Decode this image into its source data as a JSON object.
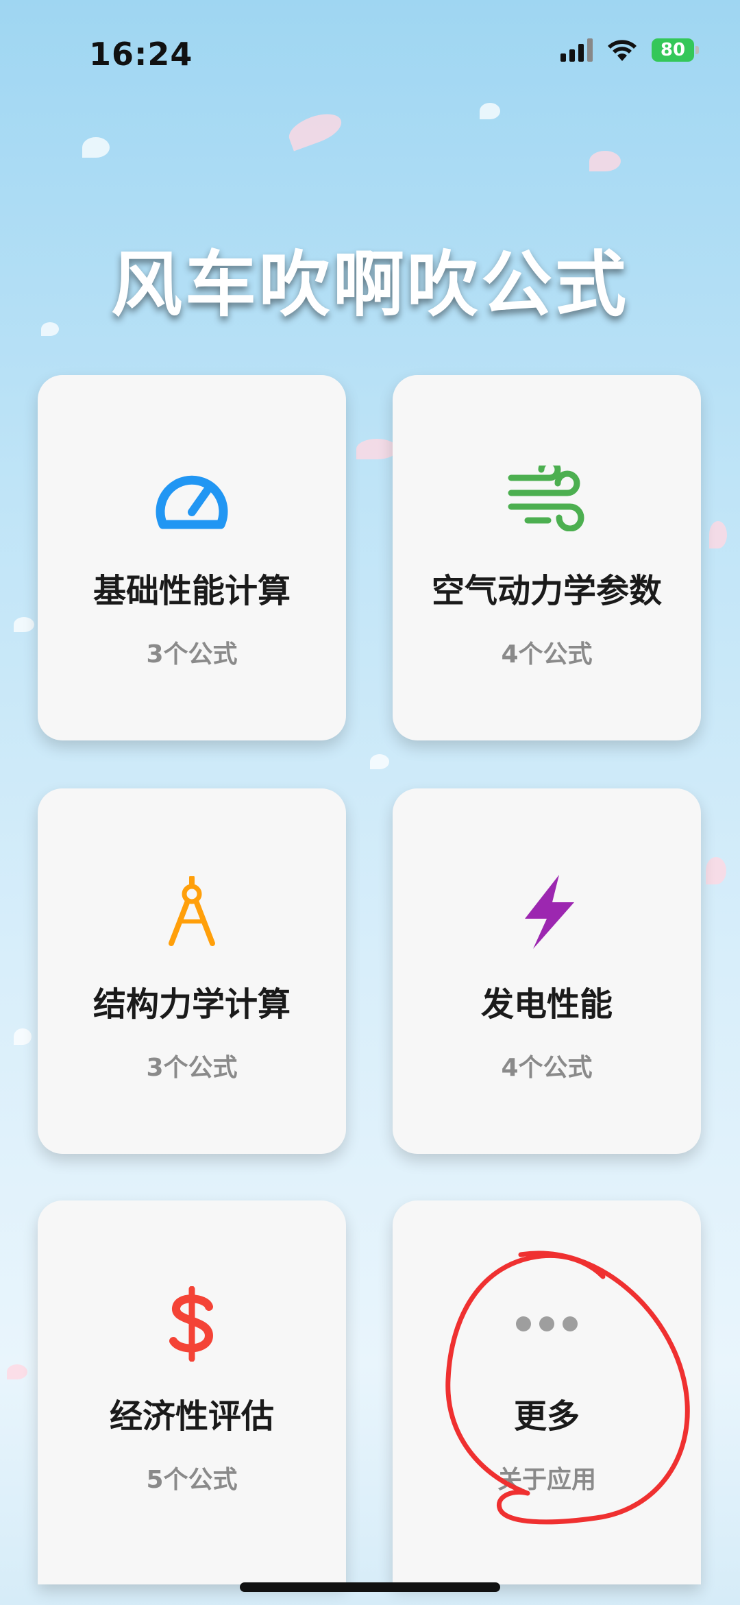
{
  "status_bar": {
    "time": "16:24",
    "battery": "80"
  },
  "app": {
    "title": "风车吹啊吹公式"
  },
  "cards": [
    {
      "title": "基础性能计算",
      "subtitle": "3个公式",
      "icon": "speedometer-icon",
      "color": "#2196f3"
    },
    {
      "title": "空气动力学参数",
      "subtitle": "4个公式",
      "icon": "wind-icon",
      "color": "#4caf50"
    },
    {
      "title": "结构力学计算",
      "subtitle": "3个公式",
      "icon": "compass-tool-icon",
      "color": "#ff9f0a"
    },
    {
      "title": "发电性能",
      "subtitle": "4个公式",
      "icon": "lightning-bolt-icon",
      "color": "#9c27b0"
    },
    {
      "title": "经济性评估",
      "subtitle": "5个公式",
      "icon": "dollar-icon",
      "color": "#f44336"
    },
    {
      "title": "更多",
      "subtitle": "关于应用",
      "icon": "more-dots-icon",
      "color": "#9e9e9e"
    }
  ],
  "colors": {
    "annotation": "#ef3030",
    "battery": "#34c759"
  }
}
